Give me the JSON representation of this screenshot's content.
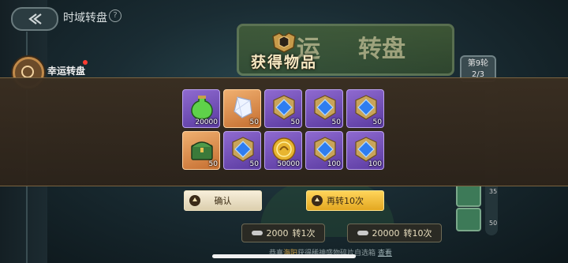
{
  "header": {
    "title": "时域转盘",
    "help_icon": "question-circle-icon"
  },
  "sidebar": {
    "item_label": "幸运转盘"
  },
  "banner": {
    "text_left": "运",
    "text_right": "转盘"
  },
  "round": {
    "label": "第9轮",
    "progress": "2/3"
  },
  "track": {
    "values": [
      "35",
      "50"
    ]
  },
  "modal": {
    "title": "获得物品",
    "items": [
      {
        "name": "green-potion-icon",
        "quantity": "20000",
        "rarity": "purple"
      },
      {
        "name": "crystal-shard-icon",
        "quantity": "50",
        "rarity": "orange"
      },
      {
        "name": "blue-gem-badge-icon",
        "quantity": "50",
        "rarity": "purple"
      },
      {
        "name": "blue-gem-badge-icon",
        "quantity": "50",
        "rarity": "purple"
      },
      {
        "name": "blue-gem-badge-icon",
        "quantity": "50",
        "rarity": "purple"
      },
      {
        "name": "treasure-chest-icon",
        "quantity": "50",
        "rarity": "orange"
      },
      {
        "name": "blue-gem-badge-icon",
        "quantity": "50",
        "rarity": "purple"
      },
      {
        "name": "gold-coin-icon",
        "quantity": "50000",
        "rarity": "purple"
      },
      {
        "name": "blue-gem-badge-icon",
        "quantity": "100",
        "rarity": "purple"
      },
      {
        "name": "blue-gem-badge-icon",
        "quantity": "100",
        "rarity": "purple"
      }
    ],
    "confirm_label": "确认",
    "again_label": "再转10次"
  },
  "spin": {
    "single_cost": "2000",
    "single_label": "转1次",
    "ten_cost": "20000",
    "ten_label": "转10次"
  },
  "footer": {
    "prefix": "恭喜",
    "player": "海阳",
    "message": "获得稀神盛物碎片自选箱",
    "link": "查看"
  }
}
